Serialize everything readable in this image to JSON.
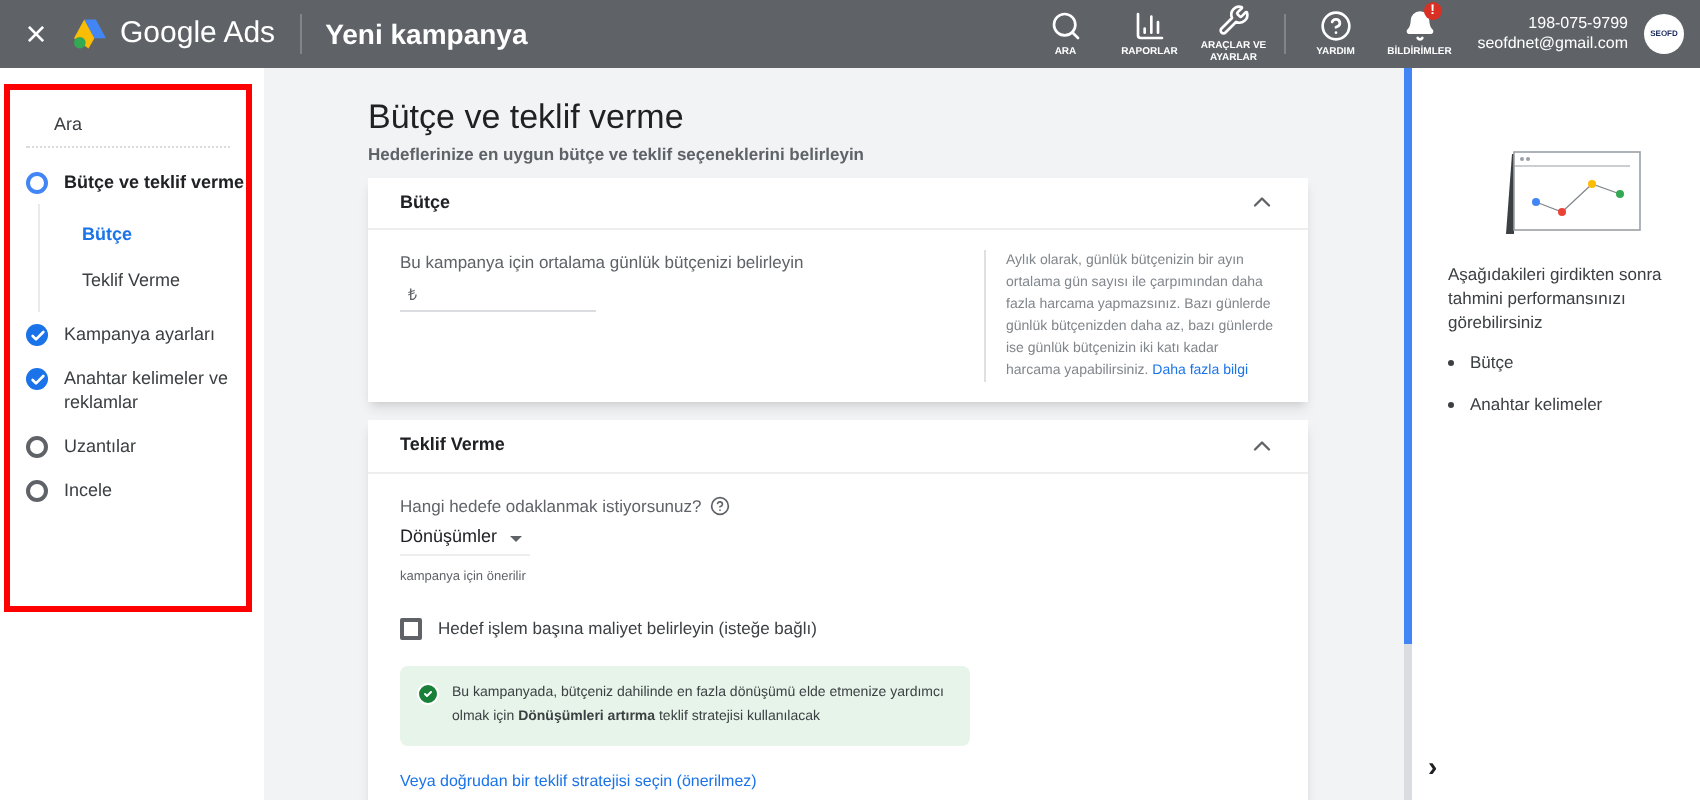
{
  "header": {
    "close": "×",
    "product": "Google Ads",
    "title": "Yeni kampanya",
    "tools": [
      {
        "kind": "search",
        "label": "ARA",
        "alert": false
      },
      {
        "kind": "reports",
        "label": "RAPORLAR",
        "alert": false
      },
      {
        "kind": "tools",
        "label": "ARAÇLAR VE AYARLAR",
        "alert": false
      },
      {
        "kind": "help",
        "label": "YARDIM",
        "alert": false
      },
      {
        "kind": "bell",
        "label": "BİLDİRİMLER",
        "alert": true,
        "badge": "!"
      }
    ],
    "account": {
      "phone": "198-075-9799",
      "email": "seofdnet@gmail.com",
      "avatar": "SEOFD"
    }
  },
  "sidebar": {
    "search": "Ara",
    "steps": [
      {
        "label": "Bütçe ve teklif verme",
        "kind": "current",
        "children": [
          {
            "label": "Bütçe",
            "selected": true
          },
          {
            "label": "Teklif Verme",
            "selected": false
          }
        ]
      },
      {
        "label": "Kampanya ayarları",
        "kind": "done"
      },
      {
        "label": "Anahtar kelimeler ve reklamlar",
        "kind": "done"
      },
      {
        "label": "Uzantılar",
        "kind": "todo"
      },
      {
        "label": "Incele",
        "kind": "todo"
      }
    ]
  },
  "main": {
    "title": "Bütçe ve teklif verme",
    "subtitle": "Hedeflerinize en uygun bütçe ve teklif seçeneklerini belirleyin",
    "budget": {
      "title": "Bütçe",
      "expanded": true,
      "field_label": "Bu kampanya için ortalama günlük bütçenizi belirleyin",
      "currency": "₺",
      "help": "Aylık olarak, günlük bütçenizin bir ayın ortalama gün sayısı ile çarpımından daha fazla harcama yapmazsınız. Bazı günlerde günlük bütçenizden daha az, bazı günlerde ise günlük bütçenizin iki katı kadar harcama yapabilirsiniz.",
      "help_link": "Daha fazla bilgi"
    },
    "bidding": {
      "title": "Teklif Verme",
      "expanded": true,
      "question": "Hangi hedefe odaklanmak istiyorsunuz?",
      "focus": "Dönüşümler",
      "hint": "kampanya için önerilir",
      "target_checkbox": {
        "label": "Hedef işlem başına maliyet belirleyin (isteğe bağlı)",
        "checked": false
      },
      "notice": "Bu kampanyada, bütçeniz dahilinde en fazla dönüşümü elde etmenize yardımcı olmak için **Dönüşümleri artırma** teklif stratejisi kullanılacak",
      "link": "Veya doğrudan bir teklif stratejisi seçin (önerilmez)"
    }
  },
  "right_panel": {
    "text": "Aşağıdakileri girdikten sonra tahmini performansınızı görebilirsiniz",
    "items": [
      "Bütçe",
      "Anahtar kelimeler"
    ],
    "toggle": "›"
  }
}
